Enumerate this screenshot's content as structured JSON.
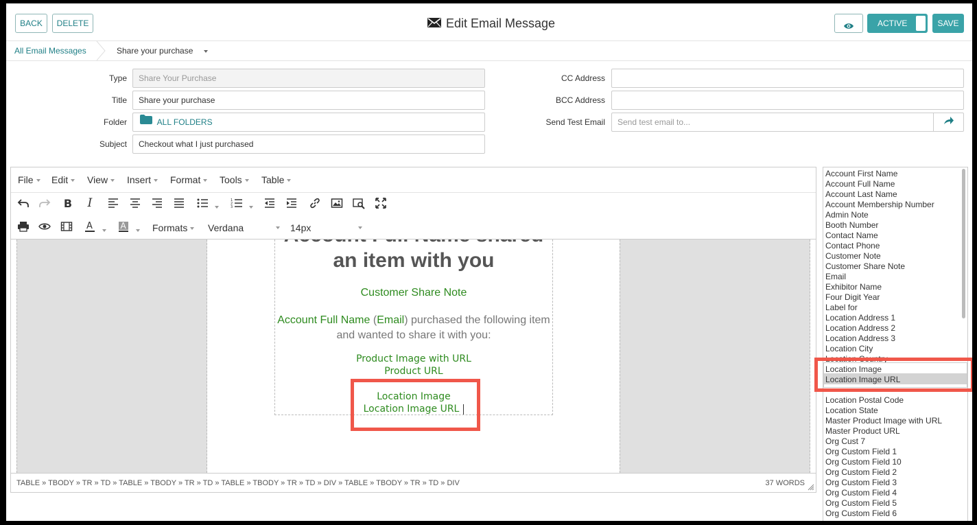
{
  "header": {
    "back": "BACK",
    "delete": "DELETE",
    "title": "Edit Email Message",
    "active": "ACTIVE",
    "save": "SAVE",
    "mail_icon": "envelope-icon",
    "preview_icon": "eye-icon"
  },
  "breadcrumb": {
    "root": "All Email Messages",
    "current": "Share your purchase"
  },
  "form": {
    "type_label": "Type",
    "type_value": "Share Your Purchase",
    "title_label": "Title",
    "title_value": "Share your purchase",
    "folder_label": "Folder",
    "folder_value": "ALL FOLDERS",
    "subject_label": "Subject",
    "subject_value": "Checkout what I just purchased",
    "cc_label": "CC Address",
    "cc_value": "",
    "bcc_label": "BCC Address",
    "bcc_value": "",
    "test_label": "Send Test Email",
    "test_placeholder": "Send test email to..."
  },
  "editor": {
    "menus": [
      "File",
      "Edit",
      "View",
      "Insert",
      "Format",
      "Tools",
      "Table"
    ],
    "formats": "Formats",
    "font": "Verdana",
    "size": "14px",
    "content": {
      "partial_heading": "Account Full Name shared",
      "heading_line2": "an item with you",
      "share_note": "Customer Share Note",
      "account_name": "Account Full Name",
      "open_paren": " (",
      "email": "Email",
      "purchase_text": ") purchased the following item and wanted to share it with you:",
      "product_image": "Product Image with URL",
      "product_url": "Product URL",
      "location_image": "Location Image",
      "location_image_url": "Location Image URL"
    },
    "statusbar": {
      "path": "TABLE » TBODY » TR » TD » TABLE » TBODY » TR » TD » TABLE » TBODY » TR » TD » DIV » TABLE » TBODY » TR » TD » DIV",
      "words": "37 WORDS"
    }
  },
  "merge_fields": {
    "top": [
      "Account First Name",
      "Account Full Name",
      "Account Last Name",
      "Account Membership Number",
      "Admin Note",
      "Booth Number",
      "Contact Name",
      "Contact Phone",
      "Customer Note",
      "Customer Share Note",
      "Email",
      "Exhibitor Name",
      "Four Digit Year",
      "Label for",
      "Location Address 1",
      "Location Address 2",
      "Location Address 3",
      "Location City",
      "Location Country"
    ],
    "highlighted": [
      "Location Image",
      "Location Image URL"
    ],
    "bottom": [
      "Location Postal Code",
      "Location State",
      "Master Product Image with URL",
      "Master Product URL",
      "Org Cust 7",
      "Org Custom Field 1",
      "Org Custom Field 10",
      "Org Custom Field 2",
      "Org Custom Field 3",
      "Org Custom Field 4",
      "Org Custom Field 5",
      "Org Custom Field 6"
    ]
  },
  "colors": {
    "accent": "#3aa3a8",
    "highlight_box": "#f0574a",
    "merge_text": "#2e8b1f"
  }
}
